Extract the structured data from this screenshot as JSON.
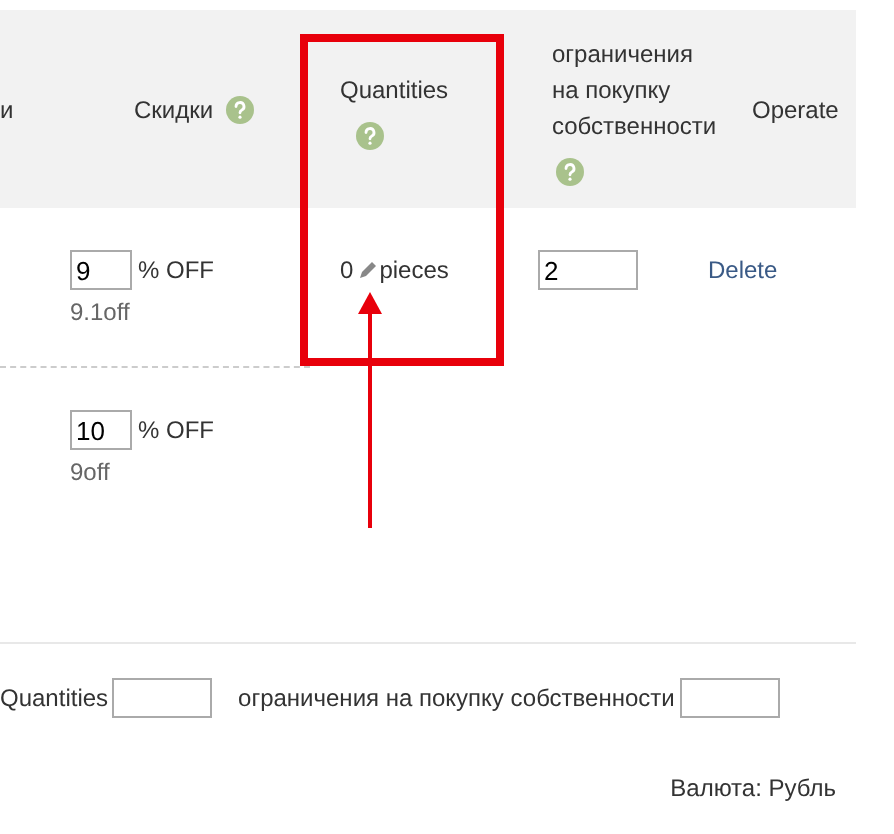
{
  "table": {
    "columns": [
      {
        "label": "и",
        "help": false
      },
      {
        "label": "Скидки",
        "help": true
      },
      {
        "label": "Quantities",
        "help": true
      },
      {
        "label": "ограничения на покупку собственности",
        "help": true
      },
      {
        "label": "Operate",
        "help": false
      }
    ],
    "rows": [
      {
        "discount": "9",
        "discount_unit": "% OFF",
        "discount_note": "9.1off",
        "quantity": "0",
        "quantity_unit": "pieces",
        "limit": "2",
        "action": "Delete"
      },
      {
        "discount": "10",
        "discount_unit": "% OFF",
        "discount_note": "9off"
      }
    ]
  },
  "batch": {
    "quantity_label": "Quantities",
    "limit_label": "ограничения на покупку собственности"
  },
  "currency": "Валюта: Рубль"
}
